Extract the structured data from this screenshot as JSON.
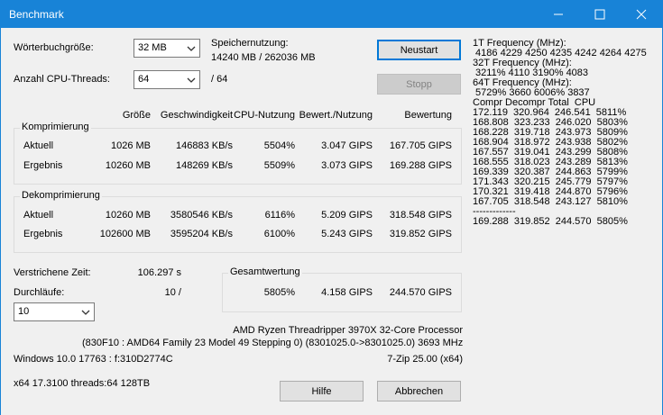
{
  "window": {
    "title": "Benchmark"
  },
  "labels": {
    "dict_size": "Wörterbuchgröße:",
    "threads": "Anzahl CPU-Threads:",
    "memory_usage": "Speichernutzung:",
    "memory_value": "14240 MB / 262036 MB",
    "threads_total": "/ 64",
    "elapsed": "Verstrichene Zeit:",
    "elapsed_value": "106.297 s",
    "passes": "Durchläufe:",
    "passes_value": "10 /",
    "total_rating": "Gesamtwertung"
  },
  "combos": {
    "dict_size": "32 MB",
    "threads": "64",
    "passes": "10"
  },
  "buttons": {
    "restart": "Neustart",
    "stop": "Stopp",
    "help": "Hilfe",
    "cancel": "Abbrechen"
  },
  "columns": {
    "size": "Größe",
    "speed": "Geschwindigkeit",
    "cpu": "CPU-Nutzung",
    "rating_usage": "Bewert./Nutzung",
    "rating": "Bewertung"
  },
  "compress": {
    "title": "Komprimierung",
    "current": {
      "label": "Aktuell",
      "size": "1026 MB",
      "speed": "146883 KB/s",
      "cpu": "5504%",
      "ru": "3.047 GIPS",
      "rating": "167.705 GIPS"
    },
    "result": {
      "label": "Ergebnis",
      "size": "10260 MB",
      "speed": "148269 KB/s",
      "cpu": "5509%",
      "ru": "3.073 GIPS",
      "rating": "169.288 GIPS"
    }
  },
  "decompress": {
    "title": "Dekomprimierung",
    "current": {
      "label": "Aktuell",
      "size": "10260 MB",
      "speed": "3580546 KB/s",
      "cpu": "6116%",
      "ru": "5.209 GIPS",
      "rating": "318.548 GIPS"
    },
    "result": {
      "label": "Ergebnis",
      "size": "102600 MB",
      "speed": "3595204 KB/s",
      "cpu": "6100%",
      "ru": "5.243 GIPS",
      "rating": "319.852 GIPS"
    }
  },
  "total": {
    "cpu": "5805%",
    "ru": "4.158 GIPS",
    "rating": "244.570 GIPS"
  },
  "system": {
    "cpu_name": "AMD Ryzen Threadripper 3970X 32-Core Processor",
    "cpu_details": "(830F10 : AMD64 Family 23 Model 49 Stepping 0) (8301025.0->8301025.0) 3693 MHz",
    "os": "Windows 10.0 17763 : f:310D2774C",
    "version": "7-Zip 25.00 (x64)",
    "build": "x64 17.3100 threads:64 128TB"
  },
  "freq": [
    "1T Frequency (MHz):",
    " 4186 4229 4250 4235 4242 4264 4275",
    "32T Frequency (MHz):",
    " 3211% 4110 3190% 4083",
    "64T Frequency (MHz):",
    " 5729% 3660 6006% 3837",
    "Compr Decompr Total  CPU",
    "172.119  320.964  246.541  5811%",
    "168.808  323.233  246.020  5803%",
    "168.228  319.718  243.973  5809%",
    "168.904  318.972  243.938  5802%",
    "167.557  319.041  243.299  5808%",
    "168.555  318.023  243.289  5813%",
    "169.339  320.387  244.863  5799%",
    "171.343  320.215  245.779  5797%",
    "170.321  319.418  244.870  5796%",
    "167.705  318.548  243.127  5810%",
    "-------------",
    "169.288  319.852  244.570  5805%"
  ]
}
